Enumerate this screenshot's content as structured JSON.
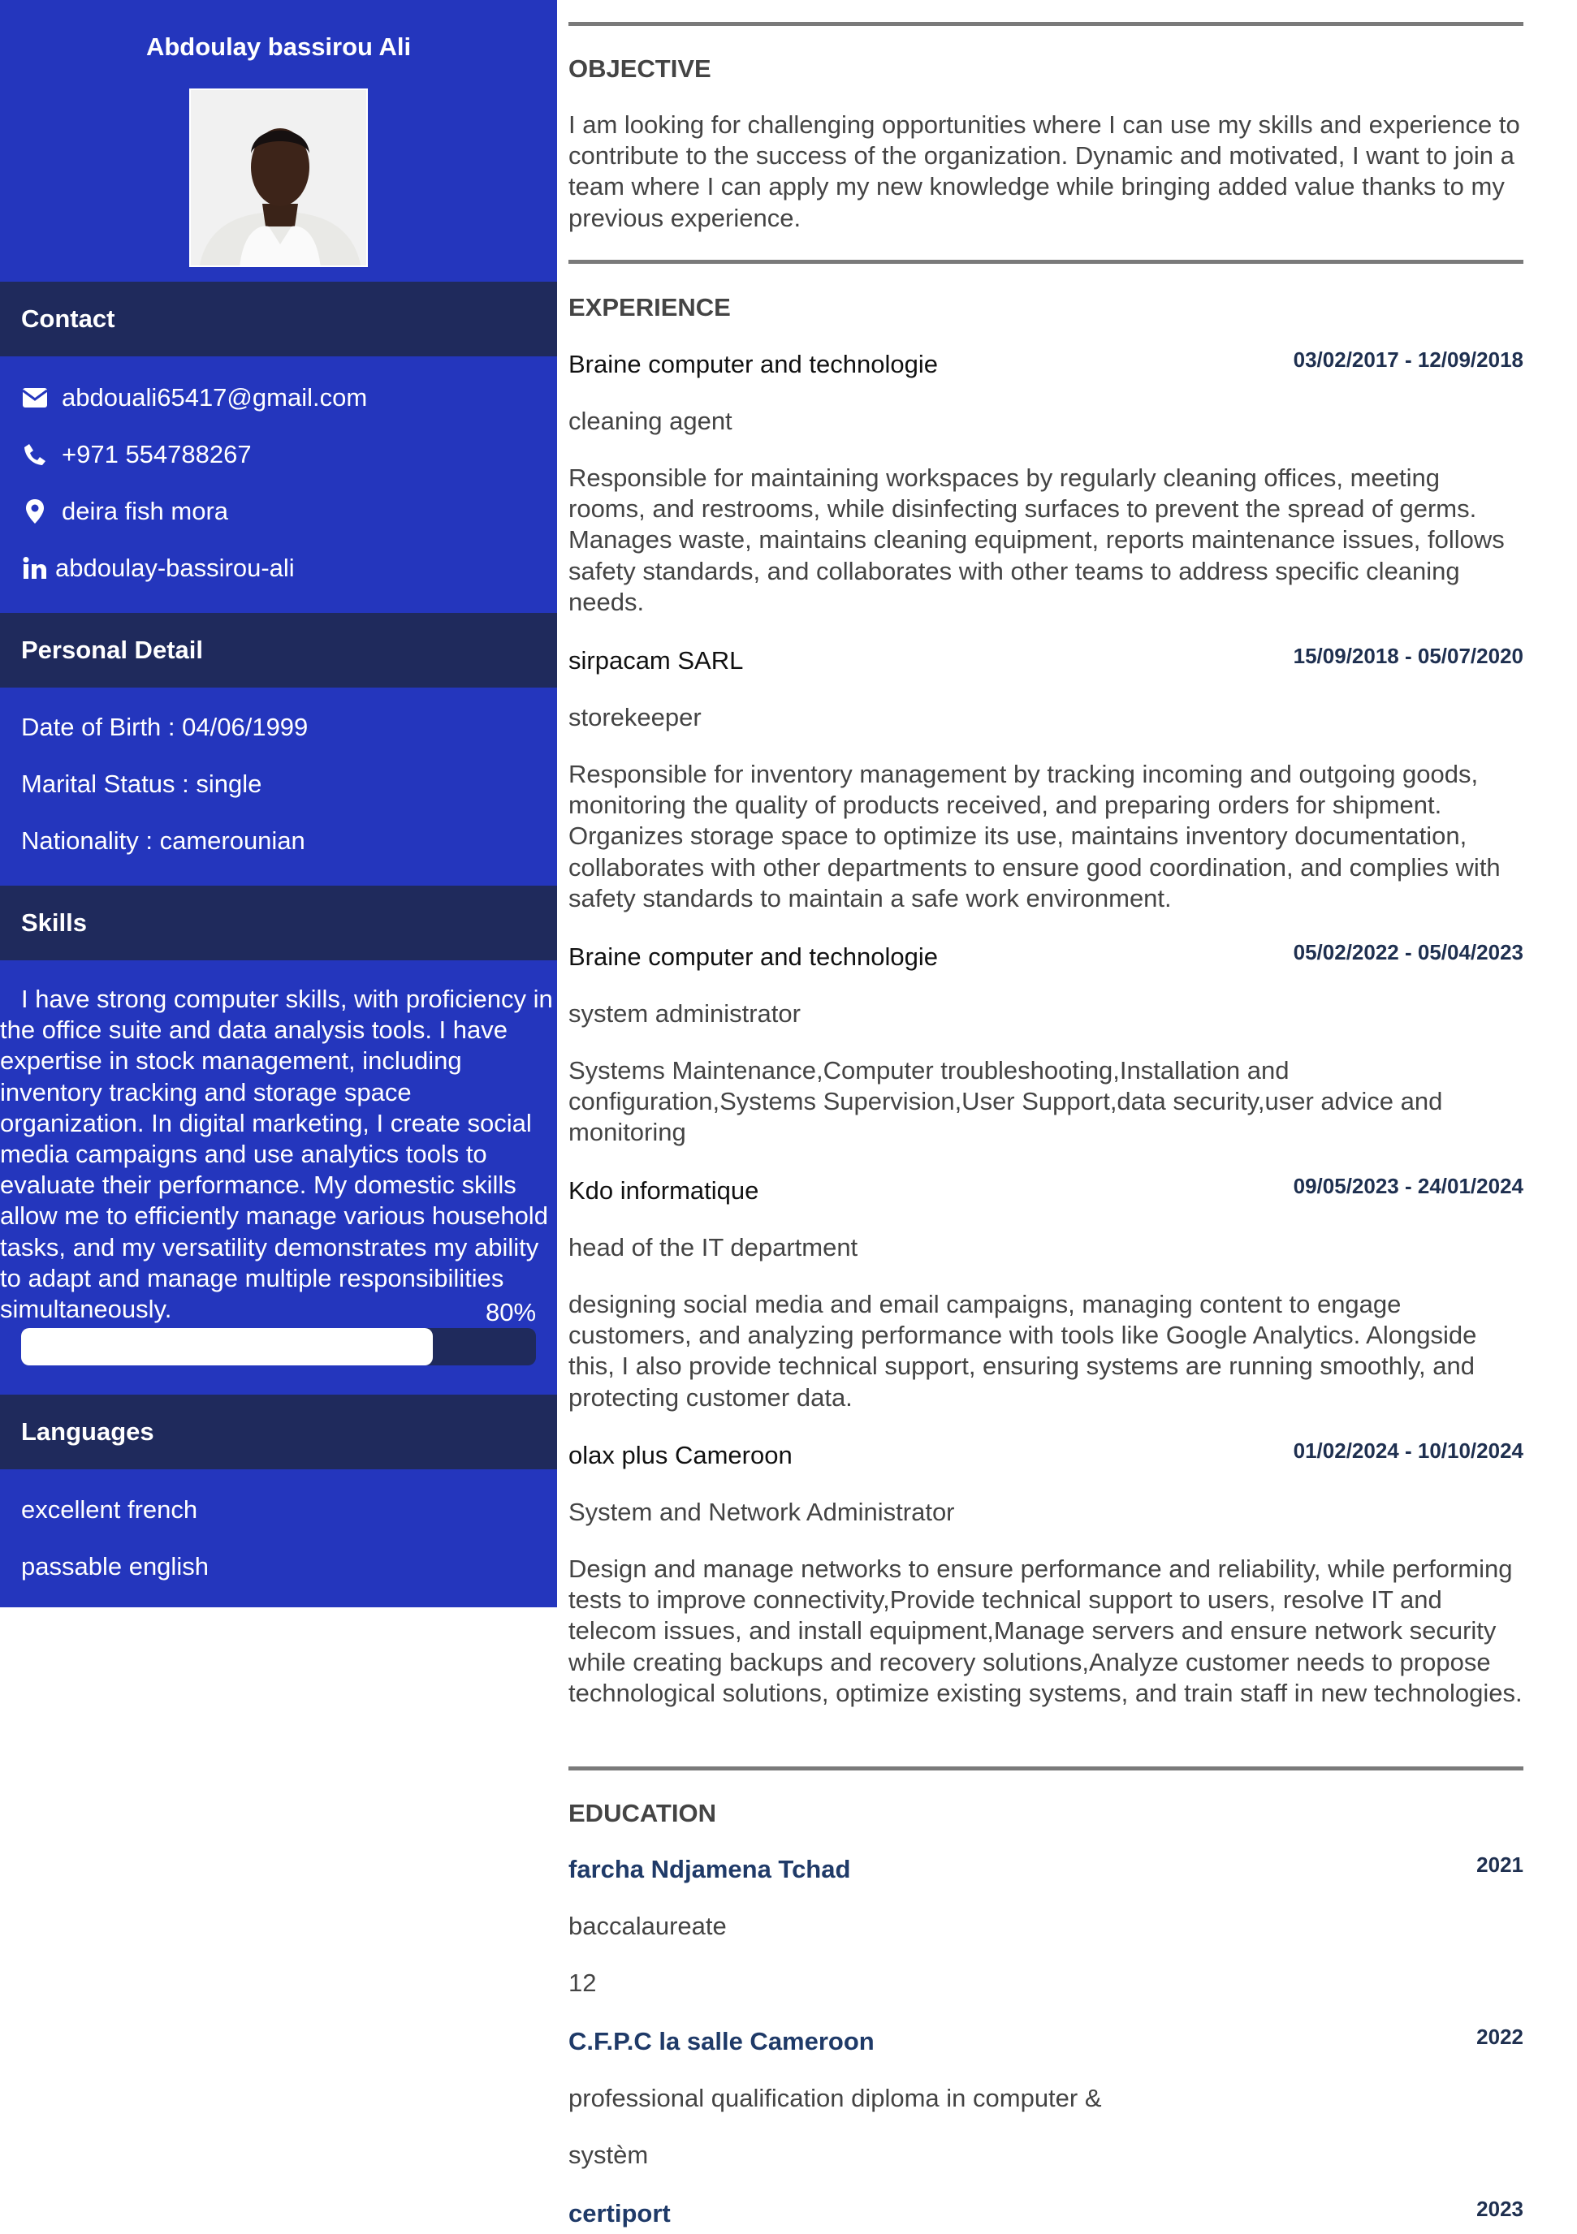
{
  "sidebar": {
    "name": "Abdoulay bassirou Ali",
    "contact_title": "Contact",
    "email": "abdouali65417@gmail.com",
    "phone": "+971 554788267",
    "address": "deira fish mora",
    "linkedin": "abdoulay-bassirou-ali",
    "personal_title": "Personal Detail",
    "dob": "Date of Birth : 04/06/1999",
    "marital": "Marital Status : single",
    "nationality": "Nationality : camerounian",
    "skills_title": "Skills",
    "skills_text": "I have strong computer skills, with proficiency in the office suite and data analysis tools. I have expertise in stock management, including inventory tracking and storage space organization. In digital marketing, I create social media campaigns and use analytics tools to evaluate their performance. My domestic skills allow me to efficiently manage various household tasks, and my versatility demonstrates my ability to adapt and manage multiple responsibilities simultaneously.",
    "skills_percent": "80%",
    "skills_level": 0.8,
    "languages_title": "Languages",
    "languages": [
      "excellent french",
      "passable english"
    ]
  },
  "objective": {
    "title": "OBJECTIVE",
    "text": "I am looking for challenging opportunities where I can use my skills and experience to contribute to the success of the organization. Dynamic and motivated, I want to join a team where I can apply my new knowledge while bringing added value thanks to my previous experience."
  },
  "experience": {
    "title": "EXPERIENCE",
    "items": [
      {
        "company": "Braine computer and technologie",
        "dates": "03/02/2017 - 12/09/2018",
        "role": "cleaning agent",
        "description": "Responsible for maintaining workspaces by regularly cleaning offices, meeting rooms, and restrooms, while disinfecting surfaces to prevent the spread of germs. Manages waste, maintains cleaning equipment, reports maintenance issues, follows safety standards, and collaborates with other teams to address specific cleaning needs."
      },
      {
        "company": "sirpacam SARL",
        "dates": "15/09/2018 - 05/07/2020",
        "role": "storekeeper",
        "description": "Responsible for inventory management by tracking incoming and outgoing goods, monitoring the quality of products received, and preparing orders for shipment. Organizes storage space to optimize its use, maintains inventory documentation, collaborates with other departments to ensure good coordination, and complies with safety standards to maintain a safe work environment."
      },
      {
        "company": "Braine computer and technologie",
        "dates": "05/02/2022 - 05/04/2023",
        "role": "system administrator",
        "description": "Systems Maintenance,Computer troubleshooting,Installation and configuration,Systems Supervision,User Support,data security,user advice and monitoring"
      },
      {
        "company": "Kdo informatique",
        "dates": "09/05/2023 - 24/01/2024",
        "role": "head of the IT department",
        "description": "designing social media and email campaigns, managing content to engage customers, and analyzing performance with tools like Google Analytics. Alongside this, I also provide technical support, ensuring systems are running smoothly, and protecting customer data."
      },
      {
        "company": "olax plus Cameroon",
        "dates": "01/02/2024 - 10/10/2024",
        "role": "System and Network Administrator",
        "description": "Design and manage networks to ensure performance and reliability, while performing tests to improve connectivity,Provide technical support to users, resolve IT and telecom issues, and install equipment,Manage servers and ensure network security while creating backups and recovery solutions,Analyze customer needs to propose technological solutions, optimize existing systems, and train staff in new technologies."
      }
    ]
  },
  "education": {
    "title": "EDUCATION",
    "items": [
      {
        "school": "farcha Ndjamena Tchad",
        "year": "2021",
        "line1": "baccalaureate",
        "line2": "12"
      },
      {
        "school": "C.F.P.C la salle Cameroon",
        "year": "2022",
        "line1": "professional qualification diploma in computer &",
        "line2": "systèm"
      },
      {
        "school": "certiport",
        "year": "2023"
      }
    ]
  },
  "icons": {
    "email": "envelope-icon",
    "phone": "phone-icon",
    "address": "map-pin-icon",
    "linkedin": "linkedin-icon"
  },
  "colors": {
    "sidebar_bg": "#2436bd",
    "band_bg": "#1f2a5c",
    "date_color": "#1f3050",
    "school_color": "#1f3a68"
  }
}
